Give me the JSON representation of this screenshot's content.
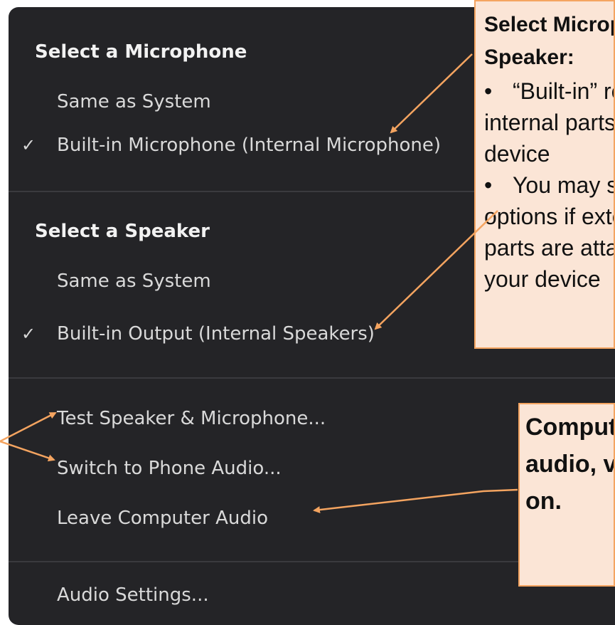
{
  "menu": {
    "microphone_header": "Select a Microphone",
    "microphone_options": [
      {
        "label": "Same as System",
        "checked": false
      },
      {
        "label": "Built-in Microphone (Internal Microphone)",
        "checked": true
      }
    ],
    "speaker_header": "Select a Speaker",
    "speaker_options": [
      {
        "label": "Same as System",
        "checked": false
      },
      {
        "label": "Built-in Output (Internal Speakers)",
        "checked": true
      }
    ],
    "check_glyph": "✓",
    "test_label": "Test Speaker & Microphone...",
    "switch_phone_label": "Switch to Phone Audio...",
    "leave_audio_label": "Leave Computer Audio",
    "settings_label": "Audio Settings..."
  },
  "annotations": {
    "top_title": "Select Microphone / Speaker:",
    "top_bullet_1": "“Built-in” refers to internal parts of your device",
    "top_bullet_2": "You may see other options if external parts are attached to your device",
    "bullet_glyph": "•",
    "bottom_text": "Computer audio, visuals, on."
  },
  "colors": {
    "menu_bg": "#242427",
    "menu_text": "#d9d9d9",
    "note_fill": "#fbe5d6",
    "note_border": "#f4a460",
    "arrow": "#f4a460"
  }
}
